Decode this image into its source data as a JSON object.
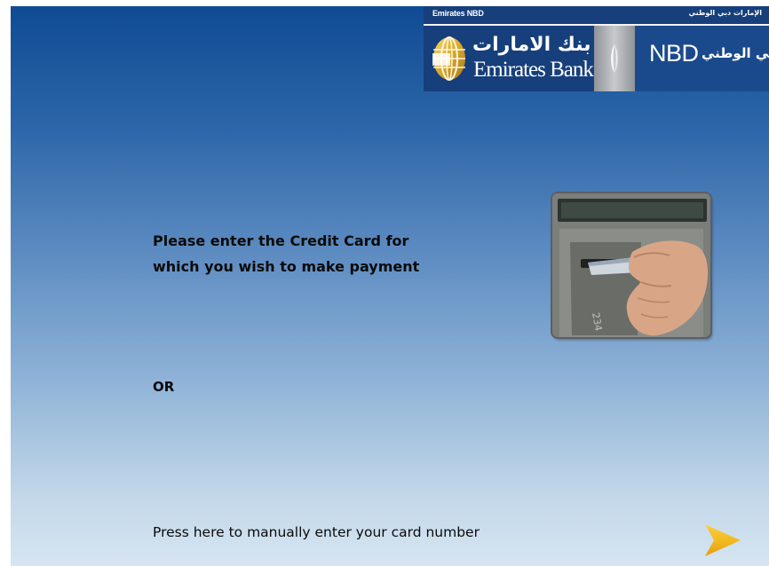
{
  "header": {
    "top_left": "Emirates NBD",
    "top_right": "الإمارات دبي الوطني",
    "emirates_bank": {
      "arabic": "بنك الامارات",
      "english": "Emirates Bank"
    },
    "nbd": {
      "english": "NBD",
      "arabic": "بنك دبي الوطني"
    }
  },
  "content": {
    "instruction_lines": [
      "Please enter the Credit Card for",
      "which you wish to make payment"
    ],
    "or_label": "OR",
    "manual_entry_label": "Press here to manually enter your card number"
  },
  "icons": {
    "logo": "globe-icon",
    "divider": "emblem-icon",
    "photo": "card-insert-photo",
    "next": "next-arrow-icon"
  },
  "colors": {
    "header_blue": "#163f7c",
    "arrow_yellow": "#f2b81f",
    "background_top": "#0f4b94",
    "background_bottom": "#d6e5f1"
  }
}
